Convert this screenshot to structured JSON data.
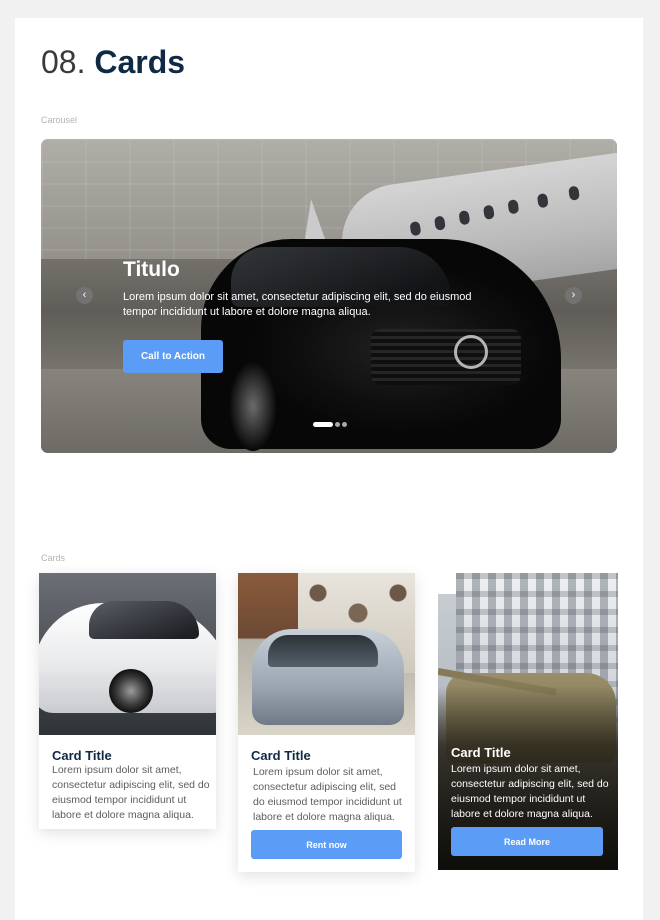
{
  "heading": {
    "number": "08.",
    "title": "Cards"
  },
  "carousel": {
    "section_label": "Carousel",
    "slide_title": "Titulo",
    "slide_text": "Lorem ipsum dolor sit amet, consectetur adipiscing elit, sed do eiusmod tempor incididunt ut labore et dolore magna aliqua.",
    "cta_label": "Call to Action",
    "prev_glyph": "‹",
    "next_glyph": "›",
    "slide_count": 3,
    "active_slide": 1
  },
  "cards": {
    "section_label": "Cards",
    "items": [
      {
        "title": "Card Title",
        "text": "Lorem ipsum dolor sit amet, consectetur adipiscing elit, sed do eiusmod tempor incididunt ut labore et dolore magna aliqua.",
        "button": ""
      },
      {
        "title": "Card Title",
        "text": "Lorem ipsum dolor sit amet, consectetur adipiscing elit, sed do eiusmod tempor incididunt ut labore et dolore magna aliqua.",
        "button": "Rent now"
      },
      {
        "title": "Card Title",
        "text": "Lorem ipsum dolor sit amet, consectetur adipiscing elit, sed do eiusmod tempor incididunt ut labore et dolore magna aliqua.",
        "button": "Read More"
      }
    ]
  },
  "colors": {
    "accent": "#5b9cf6",
    "title": "#0f2a44",
    "background": "#f1f1f1"
  },
  "icons": {
    "prev": "chevron-left-icon",
    "next": "chevron-right-icon"
  }
}
